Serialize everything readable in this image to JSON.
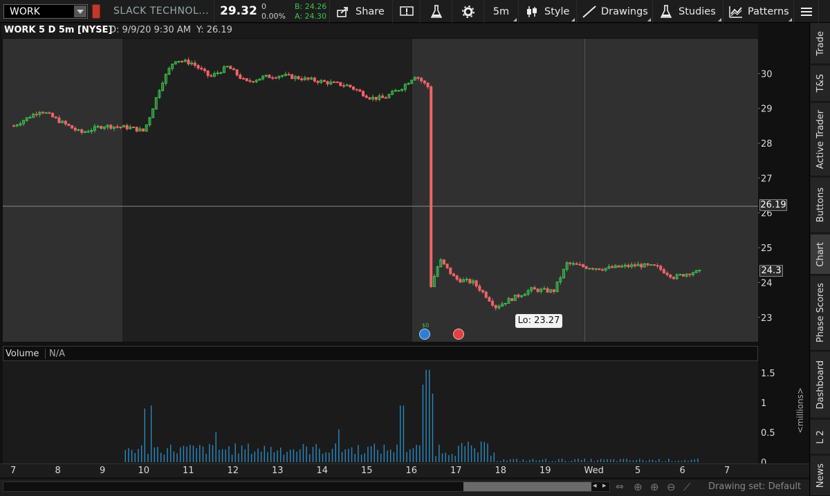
{
  "toolbar": {
    "symbol": "WORK",
    "company_name": "SLACK TECHNOL...",
    "last_price": "29.32",
    "net_change": "0",
    "percent_change": "0.00%",
    "bid": "B: 24.26",
    "ask": "A: 24.30",
    "share_label": "Share",
    "timeframe_label": "5m",
    "style_label": "Style",
    "drawings_label": "Drawings",
    "studies_label": "Studies",
    "patterns_label": "Patterns"
  },
  "chart": {
    "symbol_label": "WORK 5 D 5m [NYSE]",
    "cursor_date": "D: 9/9/20 9:30 AM",
    "cursor_y": "Y: 26.19",
    "cursor_flag": "26.19",
    "last_flag": "24.3",
    "low_label": "Lo: 23.27",
    "earnings_marker": "$0",
    "colors": {
      "up": "#3fc34f",
      "down": "#f06466",
      "volume": "#2a8bc4",
      "extended_hours": "#303030",
      "regular_hours": "#1f1f1f"
    }
  },
  "chart_data": [
    {
      "type": "candlestick",
      "title": "WORK 5 D 5m [NYSE]",
      "y_ticks": [
        23,
        24,
        25,
        26,
        27,
        28,
        29,
        30
      ],
      "ylim": [
        22.3,
        31
      ],
      "x_labels": [
        "7",
        "8",
        "9",
        "10",
        "11",
        "12",
        "13",
        "14",
        "15",
        "16",
        "17",
        "18",
        "19",
        "Wed",
        "5",
        "6",
        "7"
      ],
      "close_path": [
        [
          0,
          28.5
        ],
        [
          0.6,
          28.95
        ],
        [
          1.0,
          28.65
        ],
        [
          1.5,
          28.3
        ],
        [
          2.0,
          28.5
        ],
        [
          2.6,
          28.45
        ],
        [
          2.9,
          28.35
        ],
        [
          3.0,
          28.6
        ],
        [
          3.3,
          29.7
        ],
        [
          3.6,
          30.4
        ],
        [
          4.0,
          30.3
        ],
        [
          4.4,
          29.9
        ],
        [
          4.8,
          30.2
        ],
        [
          5.2,
          29.75
        ],
        [
          5.6,
          29.9
        ],
        [
          6.0,
          29.95
        ],
        [
          6.5,
          29.85
        ],
        [
          7.0,
          29.75
        ],
        [
          7.5,
          29.65
        ],
        [
          8.0,
          29.3
        ],
        [
          8.3,
          29.3
        ],
        [
          8.7,
          29.6
        ],
        [
          9.0,
          29.95
        ],
        [
          9.3,
          29.6
        ],
        [
          9.35,
          23.9
        ],
        [
          9.55,
          24.65
        ],
        [
          9.9,
          24.1
        ],
        [
          10.3,
          24.0
        ],
        [
          10.6,
          23.6
        ],
        [
          10.8,
          23.3
        ],
        [
          11.1,
          23.5
        ],
        [
          11.6,
          23.8
        ],
        [
          12.1,
          23.75
        ],
        [
          12.4,
          24.55
        ],
        [
          12.8,
          24.45
        ],
        [
          13.2,
          24.4
        ],
        [
          13.6,
          24.45
        ],
        [
          14.0,
          24.5
        ],
        [
          14.4,
          24.45
        ],
        [
          14.8,
          24.15
        ],
        [
          15.2,
          24.3
        ],
        [
          15.4,
          24.3
        ]
      ],
      "volume": {
        "unit": "<millions>",
        "y_ticks": [
          0,
          0.5,
          1,
          1.5
        ],
        "ylim": [
          0,
          1.65
        ],
        "peaks": [
          {
            "x": 2.95,
            "value": 0.9
          },
          {
            "x": 3.1,
            "value": 0.95
          },
          {
            "x": 4.5,
            "value": 0.5
          },
          {
            "x": 7.3,
            "value": 0.55
          },
          {
            "x": 8.7,
            "value": 0.95
          },
          {
            "x": 9.2,
            "value": 1.3
          },
          {
            "x": 9.28,
            "value": 1.55
          },
          {
            "x": 9.4,
            "value": 1.15
          }
        ]
      }
    }
  ],
  "side_tabs": [
    "Trade",
    "T&S",
    "Active Trader",
    "Buttons",
    "Chart",
    "Phase Scores",
    "Dashboard",
    "L 2",
    "News"
  ],
  "bottom": {
    "drawing_set": "Drawing set: Default"
  }
}
